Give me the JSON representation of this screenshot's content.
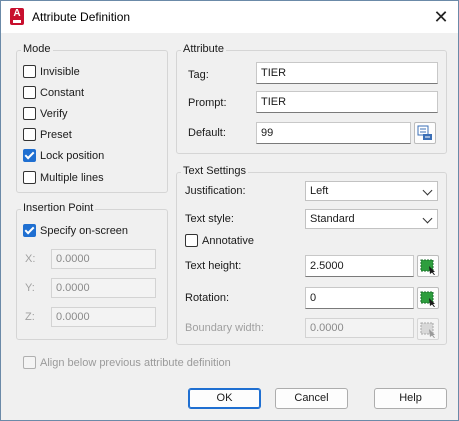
{
  "window": {
    "title": "Attribute Definition",
    "close_glyph": "✕"
  },
  "mode": {
    "title": "Mode",
    "invisible": {
      "label": "Invisible",
      "checked": false
    },
    "constant": {
      "label": "Constant",
      "checked": false
    },
    "verify": {
      "label": "Verify",
      "checked": false
    },
    "preset": {
      "label": "Preset",
      "checked": false
    },
    "lock_position": {
      "label": "Lock position",
      "checked": true
    },
    "multiple_lines": {
      "label": "Multiple lines",
      "checked": false
    }
  },
  "insertion": {
    "title": "Insertion Point",
    "specify": {
      "label": "Specify on-screen",
      "checked": true
    },
    "x": {
      "label": "X:",
      "value": "0.0000"
    },
    "y": {
      "label": "Y:",
      "value": "0.0000"
    },
    "z": {
      "label": "Z:",
      "value": "0.0000"
    }
  },
  "attribute": {
    "title": "Attribute",
    "tag": {
      "label": "Tag:",
      "value": "TIER"
    },
    "prompt": {
      "label": "Prompt:",
      "value": "TIER"
    },
    "default": {
      "label": "Default:",
      "value": "99"
    }
  },
  "text_settings": {
    "title": "Text Settings",
    "justification": {
      "label": "Justification:",
      "value": "Left"
    },
    "text_style": {
      "label": "Text style:",
      "value": "Standard"
    },
    "annotative": {
      "label": "Annotative",
      "checked": false
    },
    "text_height": {
      "label": "Text height:",
      "value": "2.5000"
    },
    "rotation": {
      "label": "Rotation:",
      "value": "0"
    },
    "boundary_width": {
      "label": "Boundary width:",
      "value": "0.0000"
    }
  },
  "align_below": {
    "label": "Align below previous attribute definition",
    "checked": false
  },
  "buttons": {
    "ok": "OK",
    "cancel": "Cancel",
    "help": "Help"
  },
  "colors": {
    "accent": "#1f6fd1",
    "app_icon": "#c8102e",
    "pick_icon": "#2e9e3e"
  }
}
